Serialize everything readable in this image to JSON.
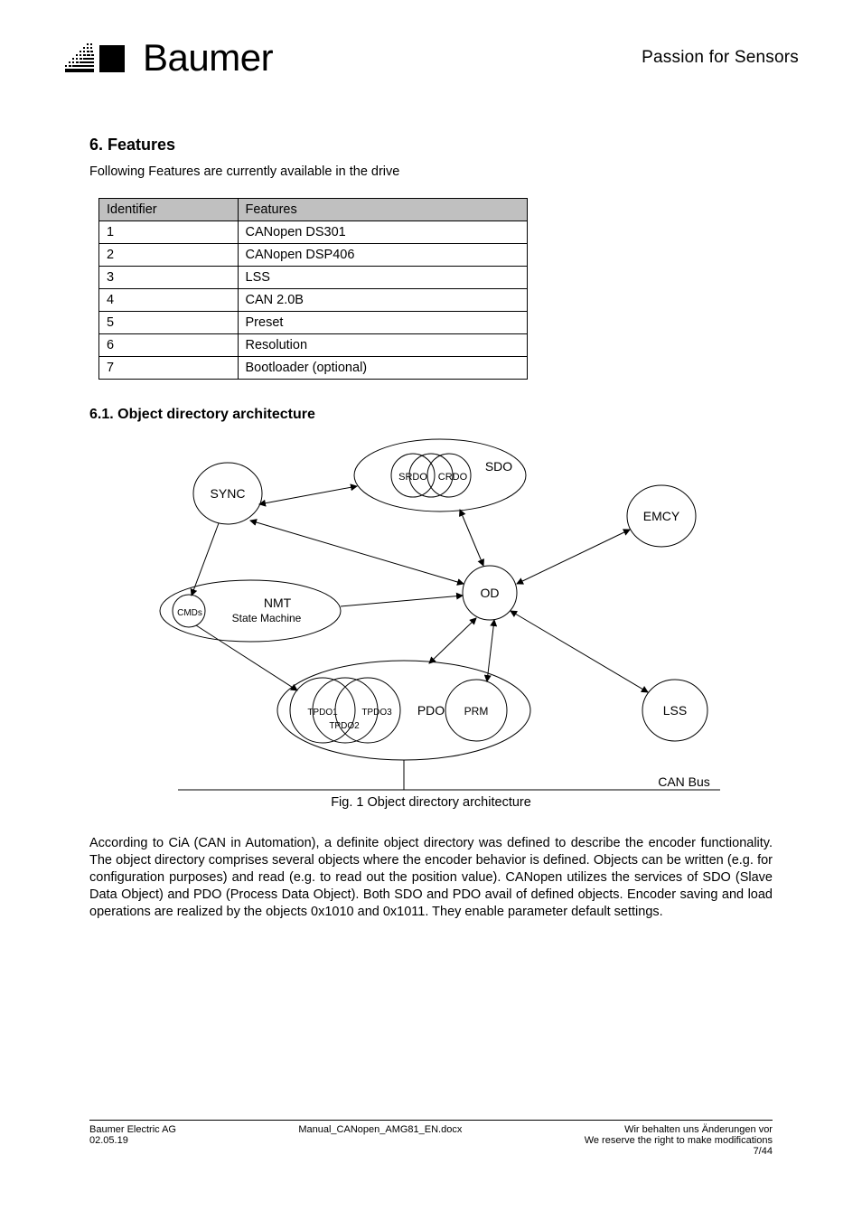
{
  "header": {
    "brand": "Baumer",
    "tagline": "Passion for Sensors"
  },
  "features": {
    "heading": "6. Features",
    "intro": "Following Features are currently available in the drive",
    "table": {
      "head": [
        "Identifier",
        "Features"
      ],
      "rows": [
        [
          "1",
          "CANopen DS301"
        ],
        [
          "2",
          "CANopen DSP406"
        ],
        [
          "3",
          "LSS"
        ],
        [
          "4",
          "CAN 2.0B"
        ],
        [
          "5",
          "Preset"
        ],
        [
          "6",
          "Resolution"
        ],
        [
          "7",
          "Bootloader (optional)"
        ]
      ]
    }
  },
  "obj_dir": {
    "heading": "6.1. Object directory architecture",
    "diagram": {
      "sync": "SYNC",
      "sdo": {
        "label": "SDO",
        "srdo": "SRDO",
        "crdo": "CRDO"
      },
      "emcy": "EMCY",
      "nmt": "NMT",
      "nmt_state": {
        "label": "State Machine",
        "cmds": "CMDs"
      },
      "pdo": {
        "label": "PDO",
        "tpdo1": "TPDO1",
        "tpdo2": "TPDO2",
        "tpdo3": "TPDO3",
        "prm": "PRM"
      },
      "lss": "LSS",
      "od": "OD",
      "bus": "CAN Bus"
    },
    "caption": "Fig. 1 Object directory architecture",
    "description": "According to CiA (CAN in Automation), a definite object directory was defined to describe the encoder functionality.  The object directory comprises several objects where the encoder behavior is defined. Objects can be written (e.g. for configuration purposes) and read (e.g. to read out the position value). CANopen utilizes the services of SDO (Slave Data Object) and PDO (Process Data Object). Both SDO and PDO avail of defined objects. Encoder saving and load operations are realized by the objects 0x1010 and 0x1011. They enable parameter default  settings."
  },
  "footer": {
    "left": "Baumer Electric AG",
    "date": "02.05.19",
    "center": "Manual_CANopen_AMG81_EN.docx",
    "right_line1": "Wir behalten uns Änderungen vor",
    "right_line2": "We reserve the right to make modifications",
    "page": "7/44"
  }
}
